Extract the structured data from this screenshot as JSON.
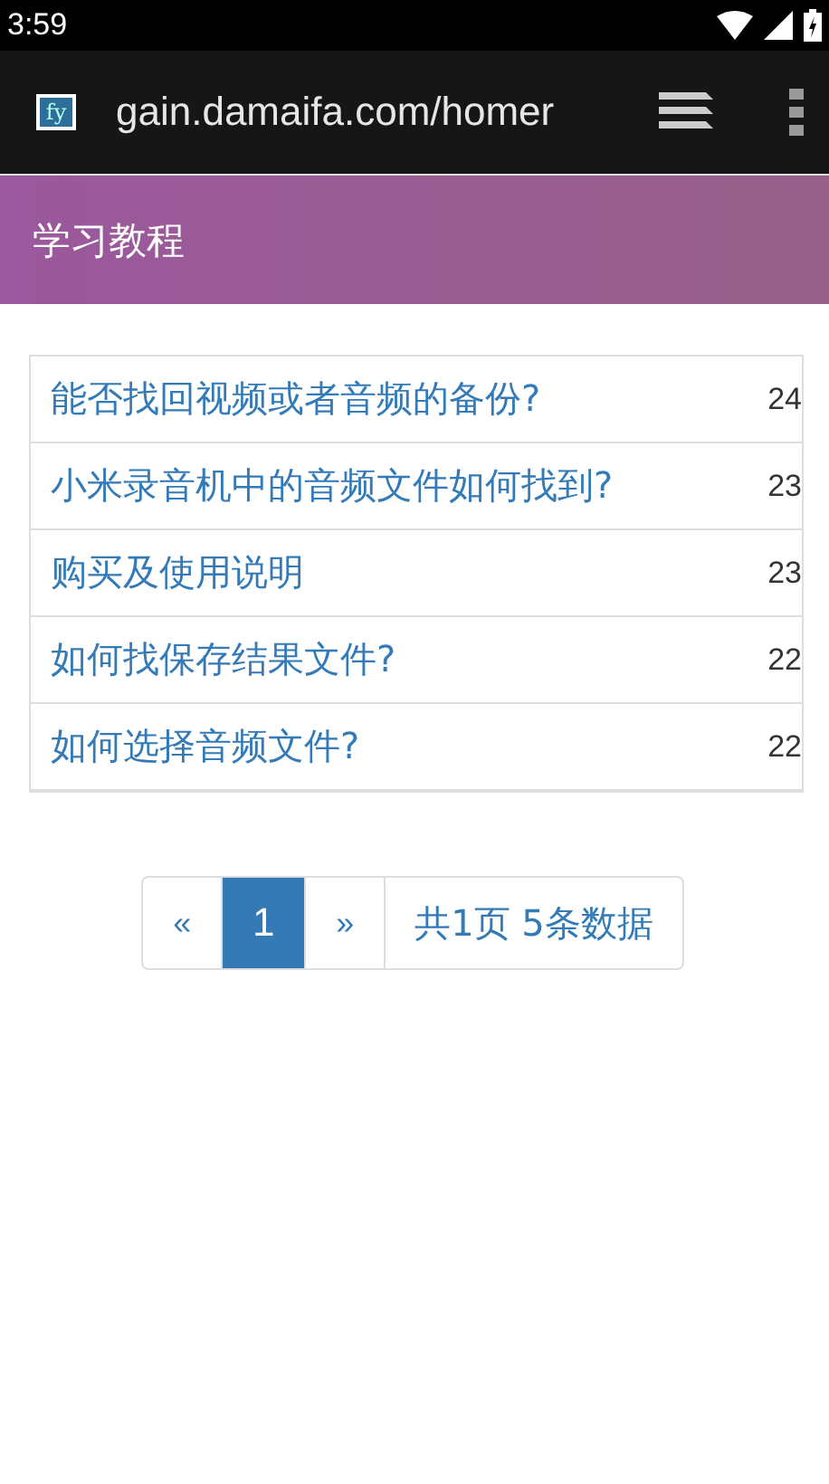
{
  "status_bar": {
    "time": "3:59"
  },
  "browser": {
    "url": "gain.damaifa.com/homer",
    "favicon": "fy"
  },
  "header": {
    "title": "学习教程"
  },
  "articles": [
    {
      "title": "能否找回视频或者音频的备份?",
      "count": "24"
    },
    {
      "title": "小米录音机中的音频文件如何找到?",
      "count": "23"
    },
    {
      "title": "购买及使用说明",
      "count": "23"
    },
    {
      "title": "如何找保存结果文件?",
      "count": "22"
    },
    {
      "title": "如何选择音频文件?",
      "count": "22"
    }
  ],
  "pagination": {
    "pages": [
      {
        "label": "«",
        "selected": false
      },
      {
        "label": "1",
        "selected": true
      },
      {
        "label": "»",
        "selected": false
      }
    ],
    "summary": "共1页 5条数据"
  }
}
